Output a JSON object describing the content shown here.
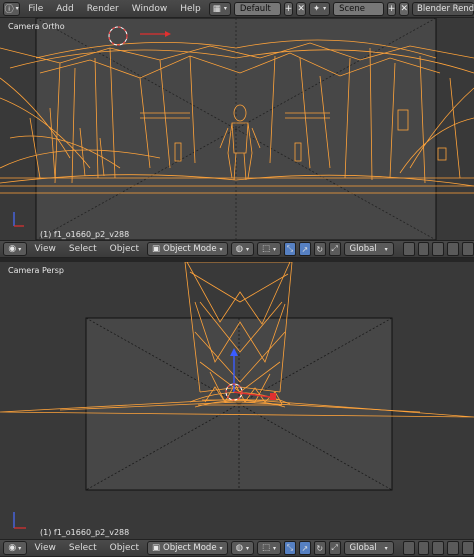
{
  "topbar": {
    "menus": [
      "File",
      "Add",
      "Render",
      "Window",
      "Help"
    ],
    "screen_layout": "Default",
    "scene": "Scene",
    "render_engine": "Blender Render"
  },
  "top_viewport": {
    "label": "Camera Ortho",
    "object": "(1) f1_o1660_p2_v288"
  },
  "bottom_viewport": {
    "label": "Camera Persp",
    "object": "(1) f1_o1660_p2_v288"
  },
  "view_header": {
    "menus": [
      "View",
      "Select",
      "Object"
    ],
    "mode": "Object Mode",
    "orientation": "Global"
  },
  "colors": {
    "wire": "#ffa33a",
    "viewport_bg": "#393939",
    "camera_frame": "#474747",
    "active_button": "#5680c2"
  }
}
